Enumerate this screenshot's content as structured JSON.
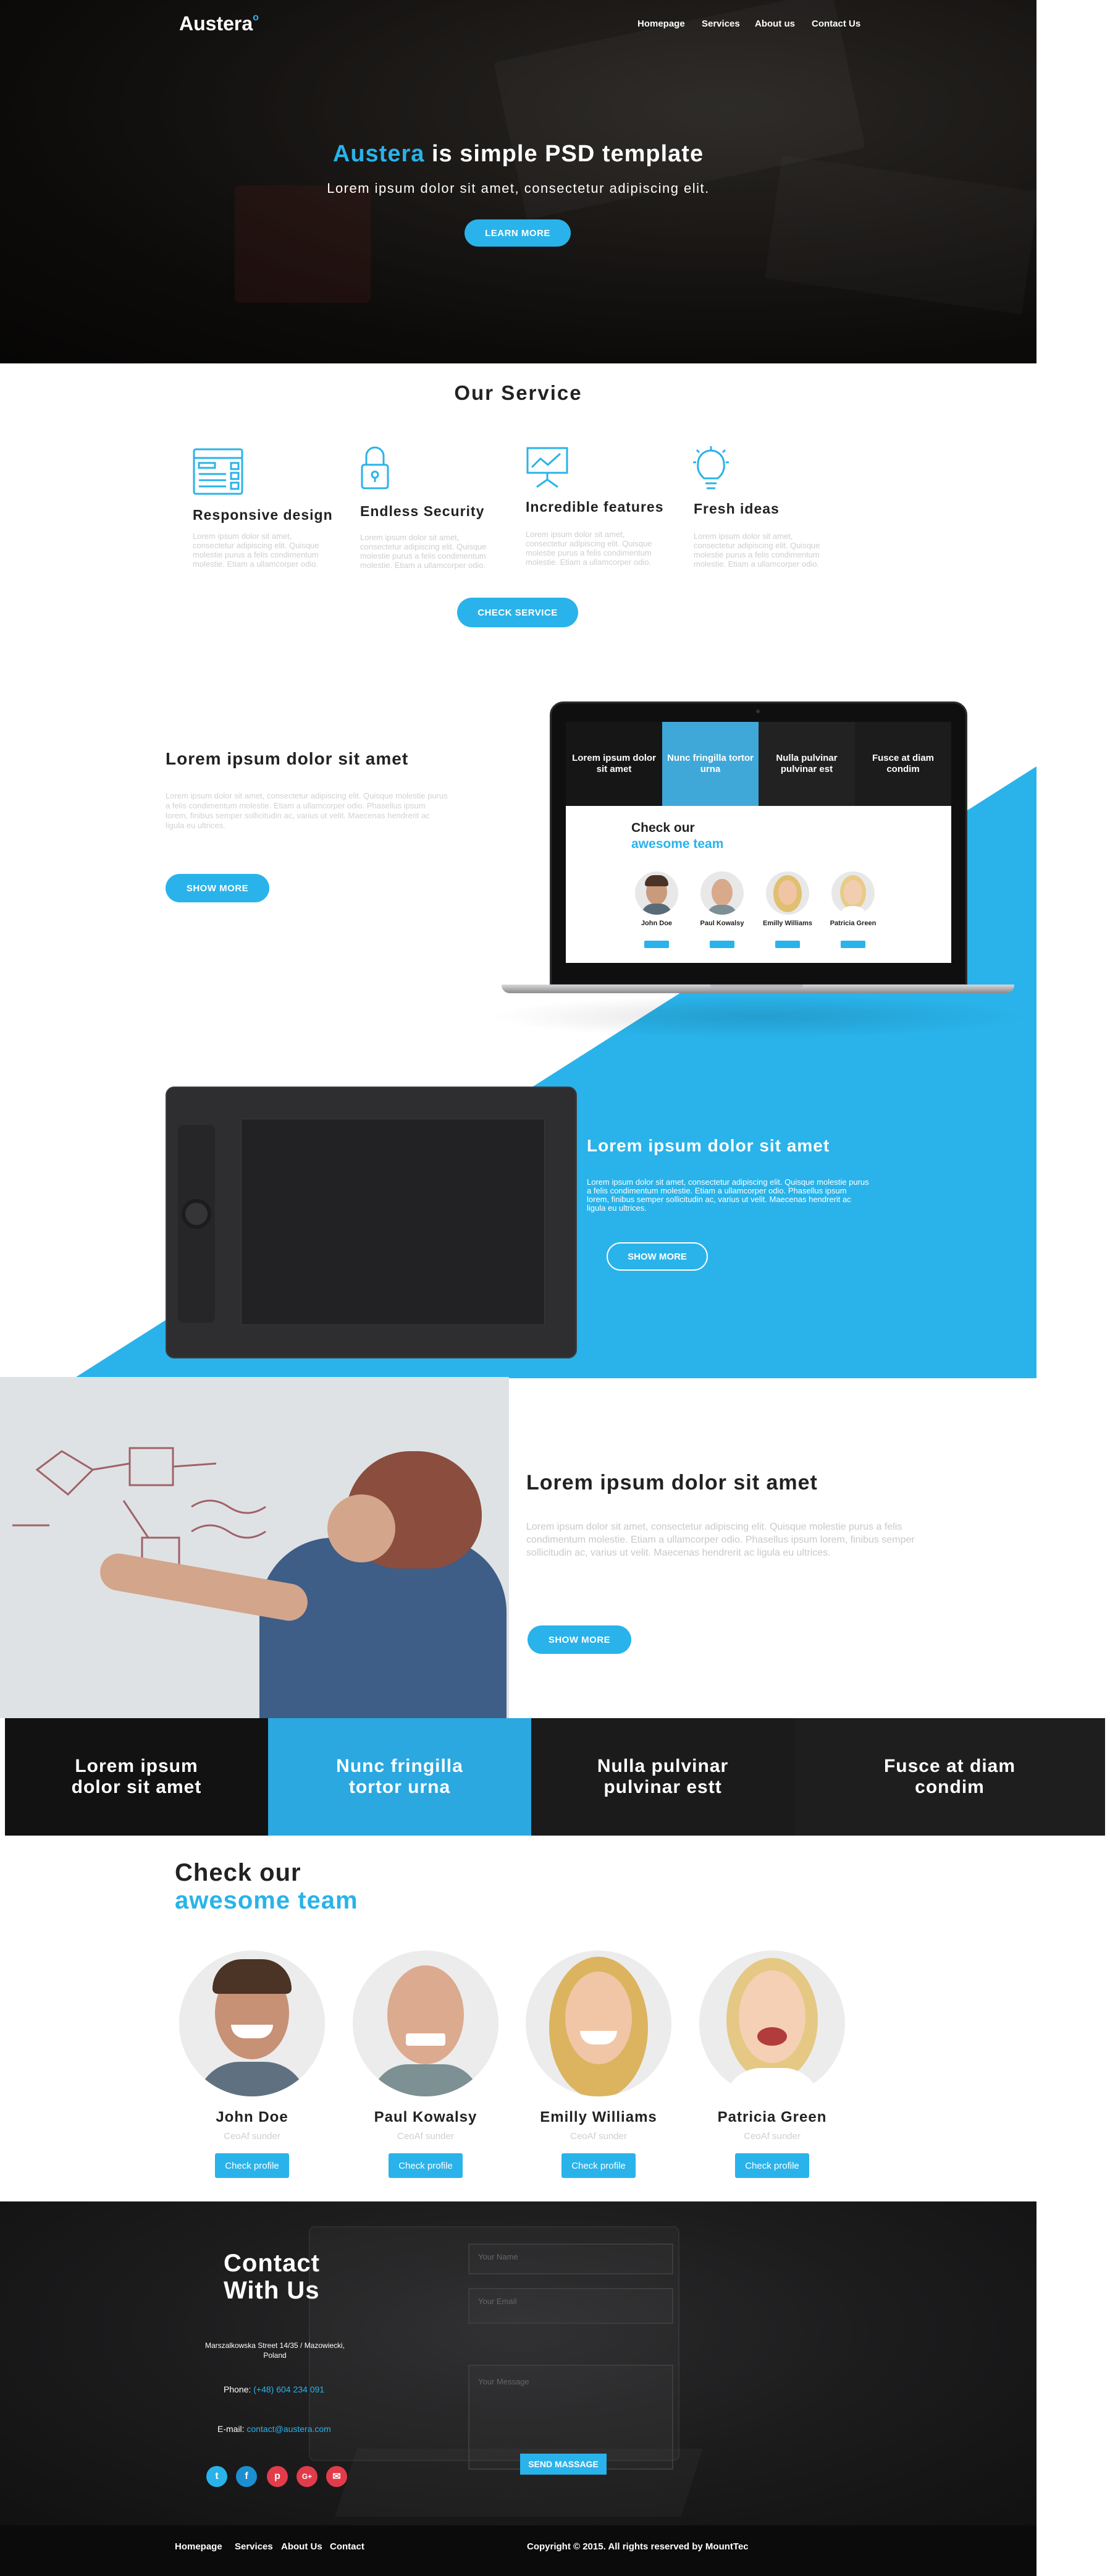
{
  "nav": {
    "logo": "Austera",
    "items": [
      "Homepage",
      "Services",
      "About us",
      "Contact Us"
    ]
  },
  "hero": {
    "title_brand": "Austera",
    "title_rest": " is simple PSD template",
    "subtitle": "Lorem ipsum dolor sit amet, consectetur adipiscing elit.",
    "cta": "LEARN MORE"
  },
  "service": {
    "heading": "Our Service",
    "items": [
      {
        "icon": "browser-icon",
        "title": "Responsive design",
        "text": "Lorem ipsum dolor sit amet, consectetur adipiscing elit. Quisque molestie purus a felis condimentum molestie. Etiam a ullamcorper odio."
      },
      {
        "icon": "lock-icon",
        "title": "Endless Security",
        "text": "Lorem ipsum dolor sit amet, consectetur adipiscing elit. Quisque molestie purus a felis condimentum molestie. Etiam a ullamcorper odio."
      },
      {
        "icon": "presentation-chart-icon",
        "title": "Incredible features",
        "text": "Lorem ipsum dolor sit amet, consectetur adipiscing elit. Quisque molestie purus a felis condimentum molestie. Etiam a ullamcorper odio."
      },
      {
        "icon": "lightbulb-icon",
        "title": "Fresh ideas",
        "text": "Lorem ipsum dolor sit amet, consectetur adipiscing elit. Quisque molestie purus a felis condimentum molestie. Etiam a ullamcorper odio."
      }
    ],
    "cta": "CHECK SERVICE"
  },
  "feature1": {
    "title": "Lorem ipsum dolor sit amet",
    "text": "Lorem ipsum dolor sit amet, consectetur adipiscing elit. Quisque molestie purus a felis condimentum molestie. Etiam a ullamcorper odio. Phasellus ipsum lorem, finibus semper sollicitudin ac, varius ut velit. Maecenas hendrerit ac ligula eu ultrices.",
    "cta": "SHOW MORE"
  },
  "laptop": {
    "tabs": [
      "Lorem ipsum dolor sit amet",
      "Nunc fringilla tortor urna",
      "Nulla pulvinar pulvinar est",
      "Fusce at diam condim"
    ],
    "team_line1": "Check our",
    "team_line2": "awesome team",
    "members": [
      "John Doe",
      "Paul Kowalsy",
      "Emilly Williams",
      "Patricia Green"
    ]
  },
  "feature2": {
    "title": "Lorem ipsum dolor sit amet",
    "text": "Lorem ipsum dolor sit amet, consectetur adipiscing elit. Quisque molestie purus a felis condimentum molestie. Etiam a ullamcorper odio. Phasellus ipsum lorem, finibus semper sollicitudin ac, varius ut velit. Maecenas hendrerit ac ligula eu ultrices.",
    "cta": "SHOW MORE"
  },
  "feature3": {
    "title": "Lorem ipsum dolor sit amet",
    "text": "Lorem ipsum dolor sit amet, consectetur adipiscing elit. Quisque molestie purus a felis condimentum molestie. Etiam a ullamcorper odio. Phasellus ipsum lorem, finibus semper sollicitudin ac, varius ut velit. Maecenas hendrerit ac ligula eu ultrices.",
    "cta": "SHOW MORE"
  },
  "strip": {
    "cells": [
      "Lorem ipsum dolor sit amet",
      "Nunc fringilla tortor urna",
      "Nulla pulvinar pulvinar estt",
      "Fusce at diam condim"
    ]
  },
  "team": {
    "line1": "Check our",
    "line2": "awesome team",
    "members": [
      {
        "name": "John Doe",
        "role": "CeoAf sunder",
        "button": "Check profile"
      },
      {
        "name": "Paul Kowalsy",
        "role": "CeoAf sunder",
        "button": "Check profile"
      },
      {
        "name": "Emilly Williams",
        "role": "CeoAf sunder",
        "button": "Check profile"
      },
      {
        "name": "Patricia Green",
        "role": "CeoAf sunder",
        "button": "Check profile"
      }
    ]
  },
  "contact": {
    "title_line1": "Contact",
    "title_line2": "With Us",
    "address_line1": "Marszalkowska Street 14/35 / Mazowiecki,",
    "address_line2": "Poland",
    "phone_label": "Phone:",
    "phone": "(+48) 604 234 091",
    "email_label": "E-mail:",
    "email": "contact@austera.com",
    "name_placeholder": "Your Name",
    "email_placeholder": "Your Email",
    "message_placeholder": "Your Message",
    "send": "SEND MASSAGE",
    "socials": [
      {
        "icon": "twitter-icon",
        "glyph": "t",
        "color": "#29b3ea"
      },
      {
        "icon": "facebook-icon",
        "glyph": "f",
        "color": "#1c8fd0"
      },
      {
        "icon": "pinterest-icon",
        "glyph": "p",
        "color": "#e23b4a"
      },
      {
        "icon": "google-plus-icon",
        "glyph": "G+",
        "color": "#e23b4a"
      },
      {
        "icon": "mail-icon",
        "glyph": "✉",
        "color": "#e23b4a"
      }
    ]
  },
  "footer": {
    "links": [
      "Homepage",
      "Services",
      "About Us",
      "Contact"
    ],
    "copyright": "Copyright © 2015. All rights reserved by MountTec"
  }
}
